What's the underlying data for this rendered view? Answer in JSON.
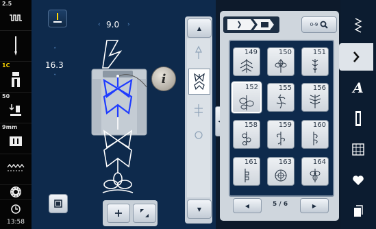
{
  "status": {
    "needle_width": "2.5",
    "presser_foot_indicator": "1C",
    "foot_pressure": "50",
    "thread_width": "9mm",
    "clock": "13:58"
  },
  "stitch": {
    "width_value": "9.0",
    "length_value": "16.3",
    "info_label": "i"
  },
  "panel": {
    "search_label": "0-9",
    "page_indicator": "5 / 6",
    "cells": [
      {
        "number": "149"
      },
      {
        "number": "150"
      },
      {
        "number": "151"
      },
      {
        "number": "152"
      },
      {
        "number": "155"
      },
      {
        "number": "156"
      },
      {
        "number": "158"
      },
      {
        "number": "159"
      },
      {
        "number": "160"
      },
      {
        "number": "161"
      },
      {
        "number": "163"
      },
      {
        "number": "164"
      }
    ],
    "selected_stitch": "152"
  },
  "categories": [
    "practical-stitches",
    "decorative-stitches",
    "alphabets",
    "buttonholes",
    "quilt-stitches",
    "favorites",
    "personal-memory"
  ],
  "accent_colors": {
    "highlight_stitch": "#1f3cff",
    "selected_border": "#ffffff"
  }
}
